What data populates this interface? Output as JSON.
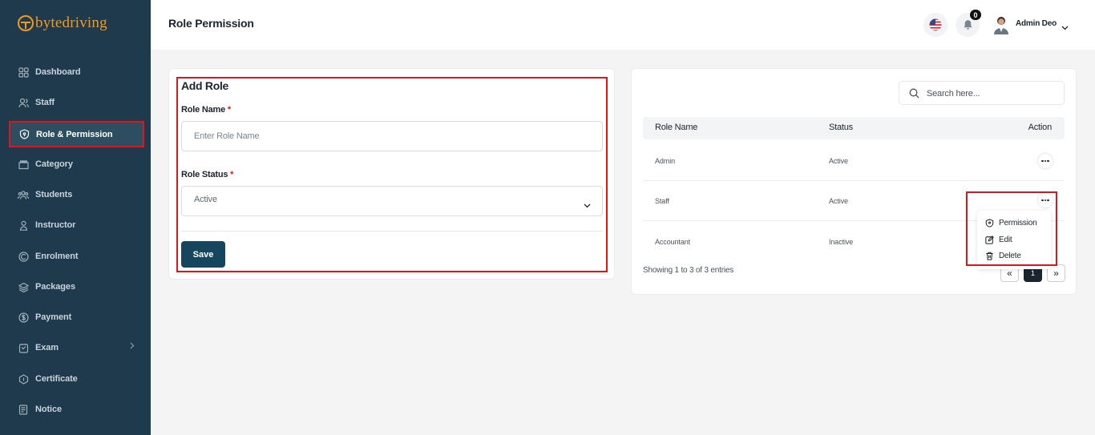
{
  "brand": {
    "name": "bytedriving"
  },
  "sidebar": {
    "items": [
      {
        "label": "Dashboard",
        "icon": "grid-icon"
      },
      {
        "label": "Staff",
        "icon": "users-icon"
      },
      {
        "label": "Role & Permission",
        "icon": "shield-icon",
        "active": true
      },
      {
        "label": "Category",
        "icon": "folder-icon"
      },
      {
        "label": "Students",
        "icon": "group-icon"
      },
      {
        "label": "Instructor",
        "icon": "user-icon"
      },
      {
        "label": "Enrolment",
        "icon": "clipboard-icon"
      },
      {
        "label": "Packages",
        "icon": "layers-icon"
      },
      {
        "label": "Payment",
        "icon": "dollar-icon"
      },
      {
        "label": "Exam",
        "icon": "exam-icon",
        "has_submenu": true
      },
      {
        "label": "Certificate",
        "icon": "award-icon"
      },
      {
        "label": "Notice",
        "icon": "file-icon"
      }
    ]
  },
  "header": {
    "title": "Role Permission",
    "notification_count": "0",
    "user_name": "Admin Deo"
  },
  "form": {
    "title": "Add Role",
    "role_name_label": "Role Name",
    "role_name_placeholder": "Enter Role Name",
    "role_name_value": "",
    "role_status_label": "Role Status",
    "role_status_value": "Active",
    "required_mark": "*",
    "save_label": "Save"
  },
  "table": {
    "search_placeholder": "Search here...",
    "columns": [
      "Role Name",
      "Status",
      "Action"
    ],
    "rows": [
      {
        "name": "Admin",
        "status": "Active"
      },
      {
        "name": "Staff",
        "status": "Active"
      },
      {
        "name": "Accountant",
        "status": "Inactive"
      }
    ],
    "showing_text": "Showing 1 to 3 of 3 entries",
    "pagination": {
      "prev": "«",
      "current": "1",
      "next": "»"
    }
  },
  "action_menu": {
    "items": [
      {
        "label": "Permission",
        "icon": "shield-icon"
      },
      {
        "label": "Edit",
        "icon": "edit-icon"
      },
      {
        "label": "Delete",
        "icon": "trash-icon"
      }
    ]
  },
  "colors": {
    "sidebar_bg": "#1e3a4c",
    "brand_orange": "#f39a1e",
    "primary_button": "#16465e",
    "highlight_red": "#e1141b"
  }
}
